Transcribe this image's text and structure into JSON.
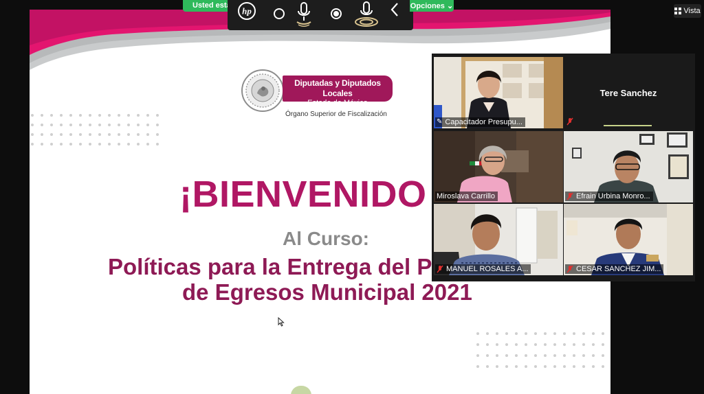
{
  "share_bar": {
    "status_text": "Usted está",
    "options_label": "Opciones",
    "view_label": "Vista"
  },
  "toolbar_icons": [
    "hp-logo-icon",
    "record-circle-icon",
    "microphone-icon",
    "record-dot-icon",
    "microphone-active-icon",
    "chevron-left-icon"
  ],
  "slide": {
    "logo_title": "Diputadas y Diputados Locales",
    "logo_subtitle": "Estado de México",
    "logo_org": "Órgano Superior de Fiscalización",
    "welcome": "¡BIENVENIDO",
    "course_label": "Al Curso:",
    "course_title_line1": "Políticas para la Entrega del Pr",
    "course_title_line2": "de Egresos Municipal 2021"
  },
  "participants": [
    {
      "name": "Capacitador Presupu...",
      "muted": false,
      "video": true,
      "active_speaker": true
    },
    {
      "name": "Tere Sanchez",
      "muted": true,
      "video": false,
      "active_speaker": false
    },
    {
      "name": "Miroslava Carrillo",
      "muted": false,
      "video": true,
      "active_speaker": false
    },
    {
      "name": "Efrain Urbina Monro...",
      "muted": true,
      "video": true,
      "active_speaker": false
    },
    {
      "name": "MANUEL ROSALES A...",
      "muted": true,
      "video": true,
      "active_speaker": false
    },
    {
      "name": "CESAR SANCHEZ JIM...",
      "muted": true,
      "video": true,
      "active_speaker": false
    }
  ],
  "colors": {
    "brand_magenta": "#b01764",
    "title_plum": "#8e1a55",
    "share_green": "#2fb95b",
    "mute_red": "#e0302f",
    "active_speaker_yellow": "#f2d94b"
  }
}
